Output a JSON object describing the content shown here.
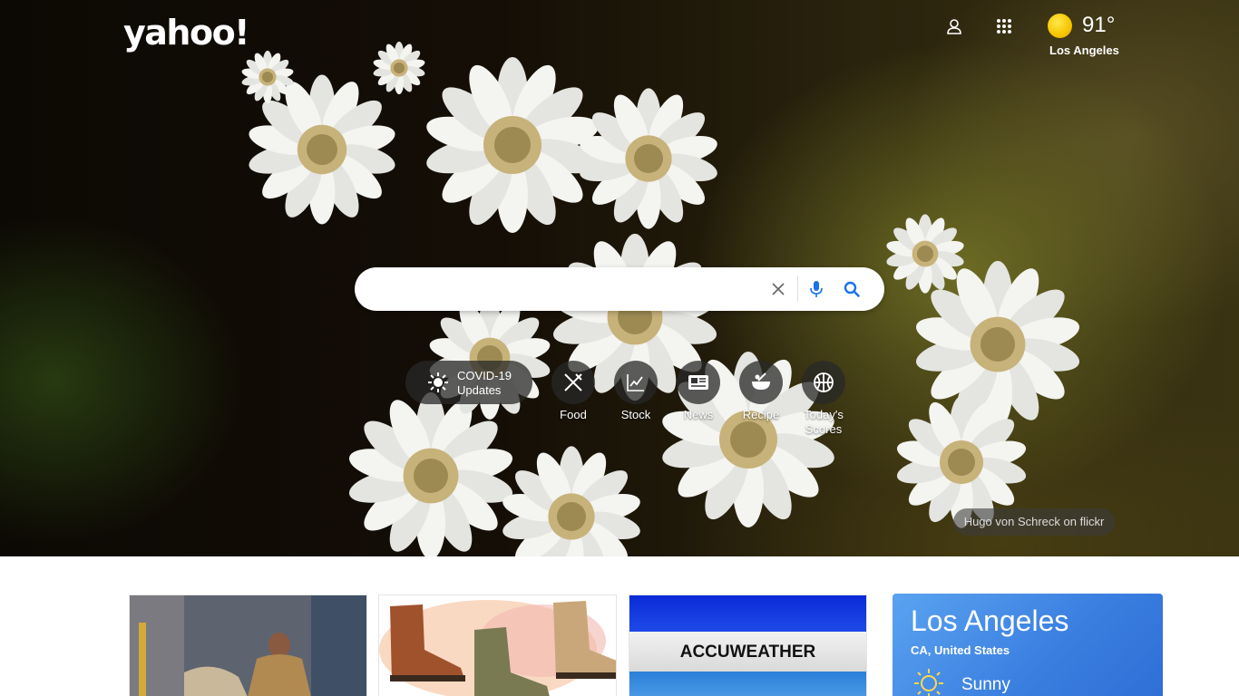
{
  "header": {
    "logo_text": "yahoo!",
    "user_icon": "user-icon",
    "apps_icon": "apps-grid-icon"
  },
  "weather_widget": {
    "icon": "sun-icon",
    "temperature": "91°",
    "city": "Los Angeles"
  },
  "search": {
    "placeholder": "",
    "value": "",
    "clear_icon": "close-icon",
    "voice_icon": "microphone-icon",
    "search_icon": "search-icon"
  },
  "quick_links": {
    "covid": {
      "line1": "COVID-19",
      "line2": "Updates",
      "icon": "virus-icon"
    },
    "items": [
      {
        "label": "Food",
        "icon": "fork-knife-icon"
      },
      {
        "label": "Stock",
        "icon": "stock-chart-icon"
      },
      {
        "label": "News",
        "icon": "newspaper-icon"
      },
      {
        "label": "Recipe",
        "icon": "bowl-icon"
      },
      {
        "label": "Today's Scores",
        "icon": "basketball-icon"
      }
    ]
  },
  "photo_credit": "Hugo von Schreck on flickr",
  "cards": {
    "accuweather_text": "ACCUWEATHER"
  },
  "weather_card": {
    "city": "Los Angeles",
    "region": "CA, United States",
    "condition": "Sunny",
    "icon": "sun-outline-icon"
  },
  "colors": {
    "accent_blue": "#2f6fd6",
    "search_icon_blue": "#1a73e8",
    "sun_yellow": "#f5c400"
  }
}
